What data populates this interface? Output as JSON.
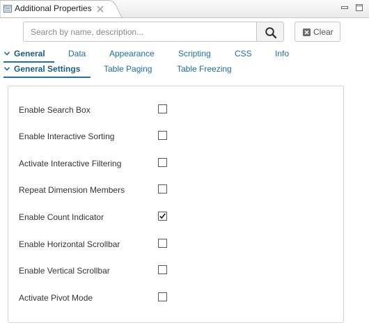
{
  "window": {
    "title": "Additional Properties",
    "close_icon": "close-x-icon",
    "minimize_icon": "minimize-icon",
    "maximize_icon": "maximize-icon"
  },
  "search": {
    "placeholder": "Search by name, description...",
    "value": "",
    "button_icon": "search-icon",
    "clear_label": "Clear",
    "clear_icon": "clear-x-icon"
  },
  "main_tabs": [
    {
      "label": "General",
      "active": true
    },
    {
      "label": "Data",
      "active": false
    },
    {
      "label": "Appearance",
      "active": false
    },
    {
      "label": "Scripting",
      "active": false
    },
    {
      "label": "CSS",
      "active": false
    },
    {
      "label": "Info",
      "active": false
    }
  ],
  "sub_tabs": [
    {
      "label": "General Settings",
      "active": true
    },
    {
      "label": "Table Paging",
      "active": false
    },
    {
      "label": "Table Freezing",
      "active": false
    }
  ],
  "settings": [
    {
      "label": "Enable Search Box",
      "checked": false
    },
    {
      "label": "Enable Interactive Sorting",
      "checked": false
    },
    {
      "label": "Activate Interactive Filtering",
      "checked": false
    },
    {
      "label": "Repeat Dimension Members",
      "checked": false
    },
    {
      "label": "Enable Count Indicator",
      "checked": true
    },
    {
      "label": "Enable Horizontal Scrollbar",
      "checked": false
    },
    {
      "label": "Enable Vertical Scrollbar",
      "checked": false
    },
    {
      "label": "Activate Pivot Mode",
      "checked": false
    }
  ],
  "colors": {
    "accent": "#1f70a8",
    "link": "#1a6fa7"
  }
}
